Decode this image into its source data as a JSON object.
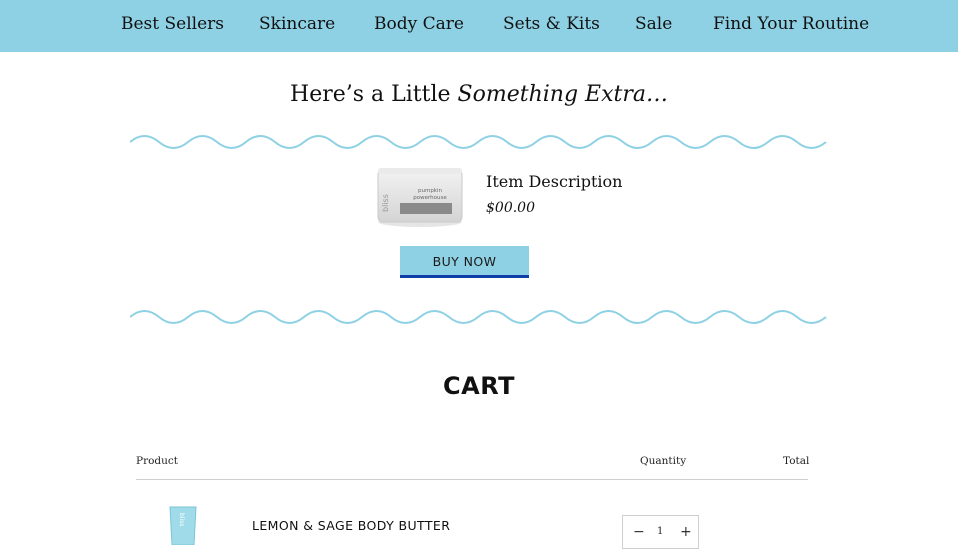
{
  "nav": {
    "items": [
      {
        "label": "Best Sellers"
      },
      {
        "label": "Skincare"
      },
      {
        "label": "Body Care"
      },
      {
        "label": "Sets & Kits"
      },
      {
        "label": "Sale"
      },
      {
        "label": "Find Your Routine"
      }
    ]
  },
  "promo": {
    "heading_prefix": "Here’s a Little ",
    "heading_emphasis": "Something Extra…",
    "item_description": "Item Description",
    "item_price": "$00.00",
    "buy_button": "BUY NOW",
    "product_brand": "bliss",
    "product_label_1": "pumpkin",
    "product_label_2": "powerhouse"
  },
  "cart": {
    "title": "CART",
    "columns": {
      "product": "Product",
      "quantity": "Quantity",
      "total": "Total"
    },
    "items": [
      {
        "name": "LEMON & SAGE BODY BUTTER",
        "quantity": "1",
        "brand": "bliss"
      }
    ]
  },
  "colors": {
    "nav_bg": "#8fd1e4",
    "wave": "#8fd1e4",
    "button_bg": "#8fd1e4",
    "button_border": "#0f3ea8"
  }
}
